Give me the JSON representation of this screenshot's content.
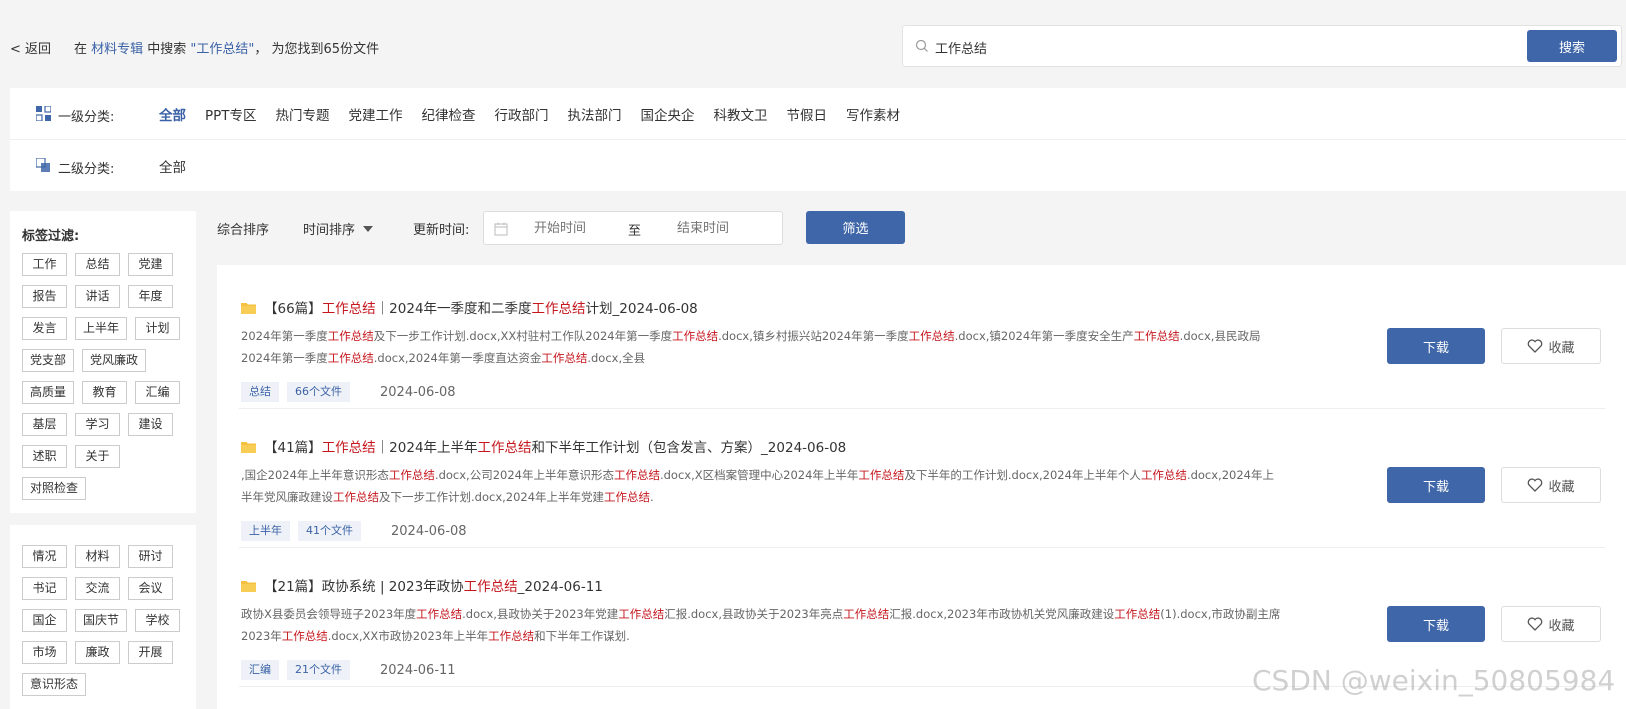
{
  "top": {
    "back_label": "< 返回",
    "summary_pre": "在 ",
    "summary_scope": "材料专辑",
    "summary_mid": " 中搜索 ",
    "summary_query": "\"工作总结\"",
    "summary_post": "， 为您找到65份文件",
    "search_value": "工作总结",
    "search_button": "搜索"
  },
  "categories": {
    "level1_label": "一级分类:",
    "level1_items": [
      "全部",
      "PPT专区",
      "热门专题",
      "党建工作",
      "纪律检查",
      "行政部门",
      "执法部门",
      "国企央企",
      "科教文卫",
      "节假日",
      "写作素材"
    ],
    "level1_active": "全部",
    "level2_label": "二级分类:",
    "level2_items": [
      "全部"
    ]
  },
  "tag_filter": {
    "title": "标签过滤:",
    "group1": [
      "工作",
      "总结",
      "党建",
      "报告",
      "讲话",
      "年度",
      "发言",
      "上半年",
      "计划",
      "党支部",
      "党风廉政",
      "高质量",
      "教育",
      "汇编",
      "基层",
      "学习",
      "建设",
      "述职",
      "关于",
      "对照检查"
    ],
    "group2": [
      "情况",
      "材料",
      "研讨",
      "书记",
      "交流",
      "会议",
      "国企",
      "国庆节",
      "学校",
      "市场",
      "廉政",
      "开展",
      "意识形态"
    ]
  },
  "filter_bar": {
    "sort_default": "综合排序",
    "sort_time": "时间排序",
    "update_label": "更新时间:",
    "start_placeholder": "开始时间",
    "range_sep": "至",
    "end_placeholder": "结束时间",
    "filter_button": "筛选"
  },
  "results": [
    {
      "title": [
        [
          "【66篇】",
          ""
        ],
        [
          "工作总结",
          "red"
        ],
        [
          "｜2024年一季度和二季度",
          ""
        ],
        [
          "工作总结",
          "red"
        ],
        [
          "计划_2024-06-08",
          ""
        ]
      ],
      "desc": [
        [
          "2024年第一季度",
          ""
        ],
        [
          "工作总结",
          "red"
        ],
        [
          "及下一步工作计划.docx,XX村驻村工作队2024年第一季度",
          ""
        ],
        [
          "工作总结",
          "red"
        ],
        [
          ".docx,镇乡村振兴站2024年第一季度",
          ""
        ],
        [
          "工作总结",
          "red"
        ],
        [
          ".docx,镇2024年第一季度安全生产",
          ""
        ],
        [
          "工作总结",
          "red"
        ],
        [
          ".docx,县民政局2024年第一季度",
          ""
        ],
        [
          "工作总结",
          "red"
        ],
        [
          ".docx,2024年第一季度直达资金",
          ""
        ],
        [
          "工作总结",
          "red"
        ],
        [
          ".docx,全县",
          ""
        ]
      ],
      "tag": "总结",
      "count": "66个文件",
      "date": "2024-06-08",
      "download": "下载",
      "favorite": "收藏"
    },
    {
      "title": [
        [
          "【41篇】",
          ""
        ],
        [
          "工作总结",
          "red"
        ],
        [
          "｜2024年上半年",
          ""
        ],
        [
          "工作总结",
          "red"
        ],
        [
          "和下半年工作计划（包含发言、方案）_2024-06-08",
          ""
        ]
      ],
      "desc": [
        [
          ",国企2024年上半年意识形态",
          ""
        ],
        [
          "工作总结",
          "red"
        ],
        [
          ".docx,公司2024年上半年意识形态",
          ""
        ],
        [
          "工作总结",
          "red"
        ],
        [
          ".docx,X区档案管理中心2024年上半年",
          ""
        ],
        [
          "工作总结",
          "red"
        ],
        [
          "及下半年的工作计划.docx,2024年上半年个人",
          ""
        ],
        [
          "工作总结",
          "red"
        ],
        [
          ".docx,2024年上半年党风廉政建设",
          ""
        ],
        [
          "工作总结",
          "red"
        ],
        [
          "及下一步工作计划.docx,2024年上半年党建",
          ""
        ],
        [
          "工作总结",
          "red"
        ],
        [
          ".",
          ""
        ]
      ],
      "tag": "上半年",
      "count": "41个文件",
      "date": "2024-06-08",
      "download": "下载",
      "favorite": "收藏"
    },
    {
      "title": [
        [
          "【21篇】政协系统 | 2023年政协",
          ""
        ],
        [
          "工作总结",
          "red"
        ],
        [
          "_2024-06-11",
          ""
        ]
      ],
      "desc": [
        [
          "政协X县委员会领导班子2023年度",
          ""
        ],
        [
          "工作总结",
          "red"
        ],
        [
          ".docx,县政协关于2023年党建",
          ""
        ],
        [
          "工作总结",
          "red"
        ],
        [
          "汇报.docx,县政协关于2023年亮点",
          ""
        ],
        [
          "工作总结",
          "red"
        ],
        [
          "汇报.docx,2023年市政协机关党风廉政建设",
          ""
        ],
        [
          "工作总结",
          "red"
        ],
        [
          "(1).docx,市政协副主席2023年",
          ""
        ],
        [
          "工作总结",
          "red"
        ],
        [
          ".docx,XX市政协2023年上半年",
          ""
        ],
        [
          "工作总结",
          "red"
        ],
        [
          "和下半年工作谋划.",
          ""
        ]
      ],
      "tag": "汇编",
      "count": "21个文件",
      "date": "2024-06-11",
      "download": "下载",
      "favorite": "收藏"
    }
  ],
  "watermark": "CSDN @weixin_50805984",
  "colors": {
    "accent": "#3f66a8",
    "highlight": "#c4161c",
    "link": "#3b62a6"
  },
  "icons": {
    "search": "search-icon",
    "category1": "grid-icon",
    "category2": "layers-icon",
    "calendar": "calendar-icon",
    "folder": "folder-icon",
    "favorite": "heart-icon"
  }
}
